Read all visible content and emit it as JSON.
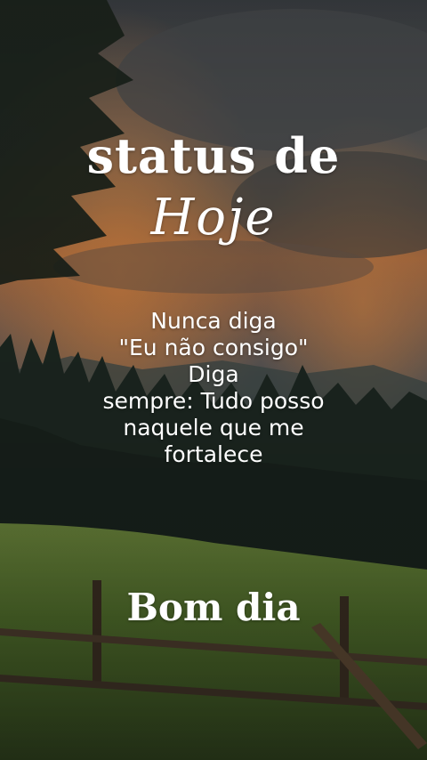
{
  "title": {
    "line1": "status de",
    "line2": "Hoje"
  },
  "quote": {
    "lines": [
      "Nunca diga",
      "\"Eu não consigo\"",
      "Diga",
      "sempre: Tudo posso",
      "naquele que me",
      "fortalece"
    ]
  },
  "greeting": "Bom dia",
  "colors": {
    "text": "#ffffff",
    "sky_dark": "#3f4447",
    "sunset": "#c8793f",
    "meadow": "#4f6d2e"
  }
}
